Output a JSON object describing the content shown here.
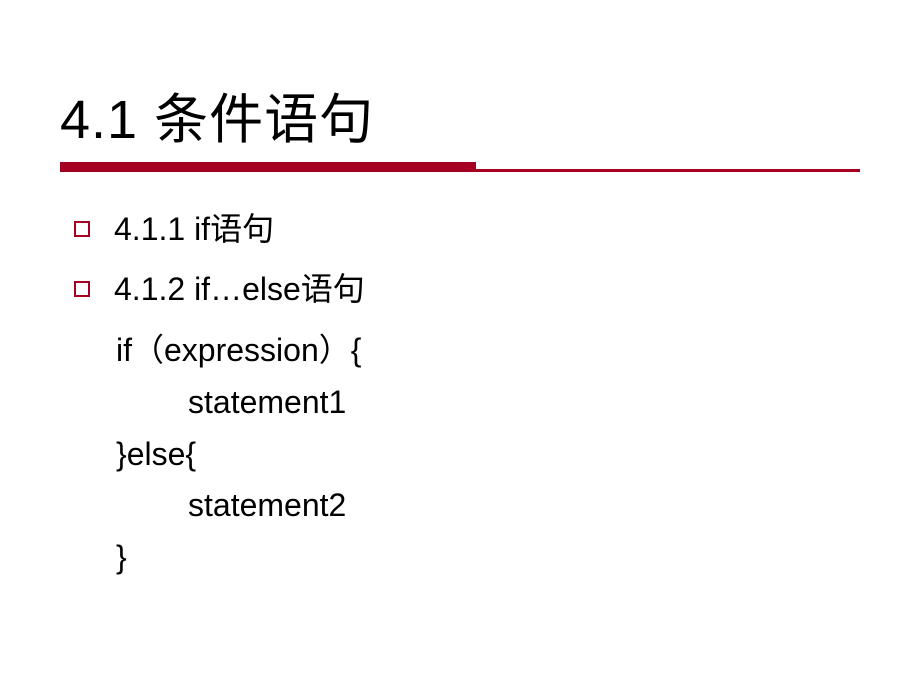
{
  "heading": "4.1  条件语句",
  "bullets": [
    {
      "label": "4.1.1 if语句"
    },
    {
      "label": "4.1.2 if…else语句"
    }
  ],
  "code": {
    "line1": "if（expression）{",
    "line2": "statement1",
    "line3": "}else{",
    "line4": "statement2",
    "line5": "}"
  }
}
